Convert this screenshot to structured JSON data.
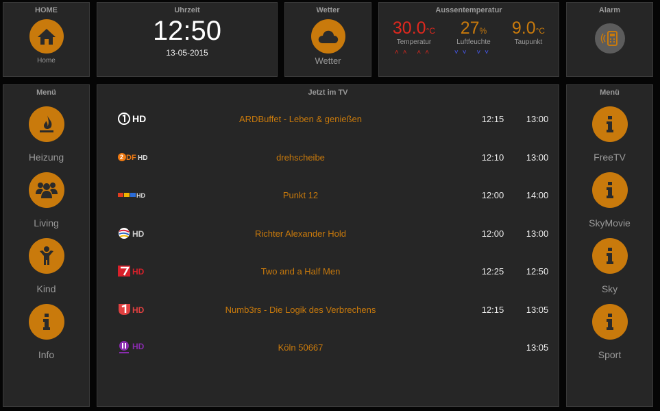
{
  "home": {
    "title": "HOME",
    "label": "Home",
    "icon": "home-icon"
  },
  "time": {
    "title": "Uhrzeit",
    "clock": "12:50",
    "date": "13-05-2015"
  },
  "weather": {
    "title": "Wetter",
    "label": "Wetter",
    "icon": "cloud-icon"
  },
  "outdoor": {
    "title": "Aussentemperatur",
    "temp": {
      "value": "30.0",
      "unit": "°C",
      "label": "Temperatur",
      "trend": "up",
      "color": "#e0281e"
    },
    "humidity": {
      "value": "27",
      "unit": "%",
      "label": "Luftfeuchte",
      "trend": "down",
      "color": "#c97a0c"
    },
    "dewpoint": {
      "value": "9.0",
      "unit": "°C",
      "label": "Taupunkt",
      "color": "#c97a0c"
    }
  },
  "alarm": {
    "title": "Alarm",
    "icon": "alarm-keypad-icon"
  },
  "left_menu": {
    "title": "Menü",
    "items": [
      {
        "label": "Heizung",
        "icon": "flame-icon"
      },
      {
        "label": "Living",
        "icon": "people-icon"
      },
      {
        "label": "Kind",
        "icon": "child-icon"
      },
      {
        "label": "Info",
        "icon": "info-icon"
      }
    ]
  },
  "tv": {
    "title": "Jetzt im TV",
    "rows": [
      {
        "channel": "ARD HD",
        "logo_text": "HD",
        "title": "ARDBuffet - Leben & genießen",
        "start": "12:15",
        "end": "13:00"
      },
      {
        "channel": "ZDF HD",
        "logo_text": "HD",
        "title": "drehscheibe",
        "start": "12:10",
        "end": "13:00"
      },
      {
        "channel": "RTL HD",
        "logo_text": "HD",
        "title": "Punkt 12",
        "start": "12:00",
        "end": "14:00"
      },
      {
        "channel": "SAT.1 HD",
        "logo_text": "HD",
        "title": "Richter Alexander Hold",
        "start": "12:00",
        "end": "13:00"
      },
      {
        "channel": "ProSieben HD",
        "logo_text": "HD",
        "title": "Two and a Half Men",
        "start": "12:25",
        "end": "12:50"
      },
      {
        "channel": "kabel eins HD",
        "logo_text": "HD",
        "title": "Numb3rs - Die Logik des Verbrechens",
        "start": "12:15",
        "end": "13:05"
      },
      {
        "channel": "RTL II HD",
        "logo_text": "HD",
        "title": "Köln 50667",
        "start": "",
        "end": "13:05"
      }
    ]
  },
  "right_menu": {
    "title": "Menü",
    "items": [
      {
        "label": "FreeTV",
        "icon": "info-icon"
      },
      {
        "label": "SkyMovie",
        "icon": "info-icon"
      },
      {
        "label": "Sky",
        "icon": "info-icon"
      },
      {
        "label": "Sport",
        "icon": "info-icon"
      }
    ]
  }
}
